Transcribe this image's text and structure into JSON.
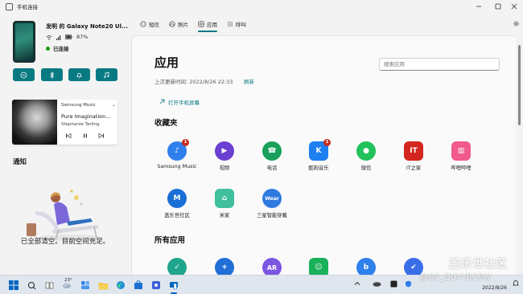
{
  "window": {
    "title": "手机连接",
    "controls": [
      "minimize",
      "maximize",
      "close"
    ]
  },
  "sidebar": {
    "device_name": "发明 的 Galaxy Note20 Ul...",
    "battery": "87%",
    "connection_status": "已连接",
    "quick_actions": [
      "do-not-disturb-icon",
      "bluetooth-icon",
      "ring-icon",
      "music-icon"
    ],
    "media": {
      "source": "Samsung Music",
      "song": "Pure Imagination...",
      "artist": "Stephanie Tarling"
    },
    "notifications_title": "通知",
    "notifications_empty": "已全部清空。目前空间充足。"
  },
  "tabs": [
    {
      "label": "短信",
      "icon": "message-icon"
    },
    {
      "label": "照片",
      "icon": "photo-icon"
    },
    {
      "label": "应用",
      "icon": "apps-icon",
      "active": true
    },
    {
      "label": "呼叫",
      "icon": "phone-icon"
    }
  ],
  "main": {
    "title": "应用",
    "last_updated": "上次更新时间: 2022/8/26 22:33",
    "refresh": "刷新",
    "search_placeholder": "搜索应用",
    "open_phone_screen": "打开手机屏幕",
    "favorites_title": "收藏夹",
    "favorites": [
      {
        "label": "Samsung Music",
        "color": "#2f80ed",
        "badge": "1",
        "icon": "music-note-icon"
      },
      {
        "label": "视频",
        "color": "#6b3fd1",
        "icon": "play-icon"
      },
      {
        "label": "电话",
        "color": "#19a05a",
        "icon": "call-icon"
      },
      {
        "label": "酷狗音乐",
        "color": "#1d7ff0",
        "badge": "1",
        "icon": "kugou-icon"
      },
      {
        "label": "微信",
        "color": "#22c25b",
        "icon": "wechat-icon"
      },
      {
        "label": "IT之家",
        "color": "#d3271f",
        "icon": "ithome-icon"
      },
      {
        "label": "哔哩哔哩",
        "color": "#f05a8c",
        "icon": "bilibili-icon"
      },
      {
        "label": "盖乐世社区",
        "color": "#1a6fd6",
        "icon": "members-icon"
      },
      {
        "label": "米家",
        "color": "#3fbf9c",
        "icon": "mijia-icon"
      },
      {
        "label": "三星智能穿戴",
        "color": "#2f7ae0",
        "icon": "wear-icon"
      }
    ],
    "all_apps_title": "所有应用",
    "all_apps": [
      {
        "color": "#1fa58b",
        "icon": "shield-check-icon"
      },
      {
        "color": "#1f6fd6",
        "icon": "shield-plus-icon"
      },
      {
        "color": "#7b56e2",
        "icon": "ar-icon"
      },
      {
        "color": "#19b15a",
        "icon": "emoji-icon"
      },
      {
        "color": "#2f80ed",
        "icon": "bixby-icon"
      },
      {
        "color": "#3a6ee8",
        "icon": "check-circle-icon"
      }
    ]
  },
  "taskbar": {
    "weather_temp": "23°",
    "date": "2022/8/26",
    "watermark_top": "盖乐世社区",
    "watermark_bottom": "@GC_QUVYBC6W"
  },
  "colors": {
    "accent": "#0a7a82",
    "badge": "#c42b1c"
  }
}
